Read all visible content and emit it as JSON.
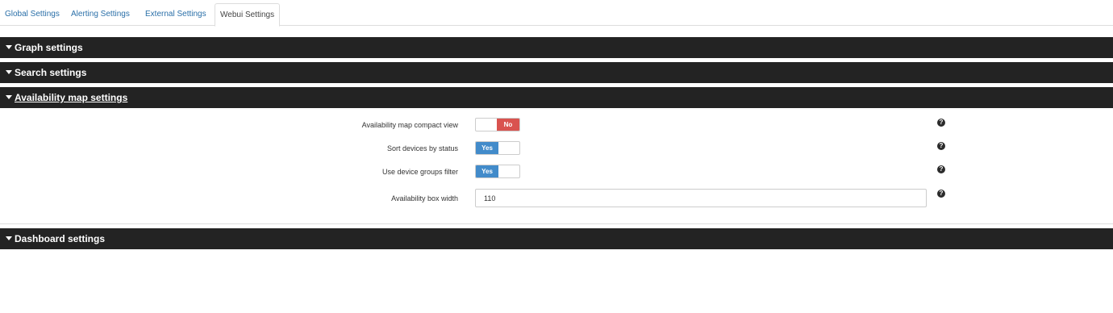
{
  "tabs": [
    {
      "label": "Global Settings",
      "active": false
    },
    {
      "label": "Alerting Settings",
      "active": false
    },
    {
      "label": "External Settings",
      "active": false
    },
    {
      "label": "Webui Settings",
      "active": true
    }
  ],
  "sections": {
    "graph": {
      "title": "Graph settings",
      "expanded": false
    },
    "search": {
      "title": "Search settings",
      "expanded": false
    },
    "availability_map": {
      "title": "Availability map settings",
      "expanded": true
    },
    "dashboard": {
      "title": "Dashboard settings",
      "expanded": false
    }
  },
  "availability_map_settings": {
    "compact_view": {
      "label": "Availability map compact view",
      "value": "No",
      "enabled": false
    },
    "sort_by_status": {
      "label": "Sort devices by status",
      "value": "Yes",
      "enabled": true
    },
    "device_groups_filter": {
      "label": "Use device groups filter",
      "value": "Yes",
      "enabled": true
    },
    "box_width": {
      "label": "Availability box width",
      "value": "110"
    }
  },
  "help_icon": {
    "name": "question-circle-icon",
    "glyph": "?"
  },
  "colors": {
    "header_bg": "#232323",
    "tab_link": "#2a6fa8",
    "toggle_on": "#428bca",
    "toggle_off": "#d9534f"
  }
}
